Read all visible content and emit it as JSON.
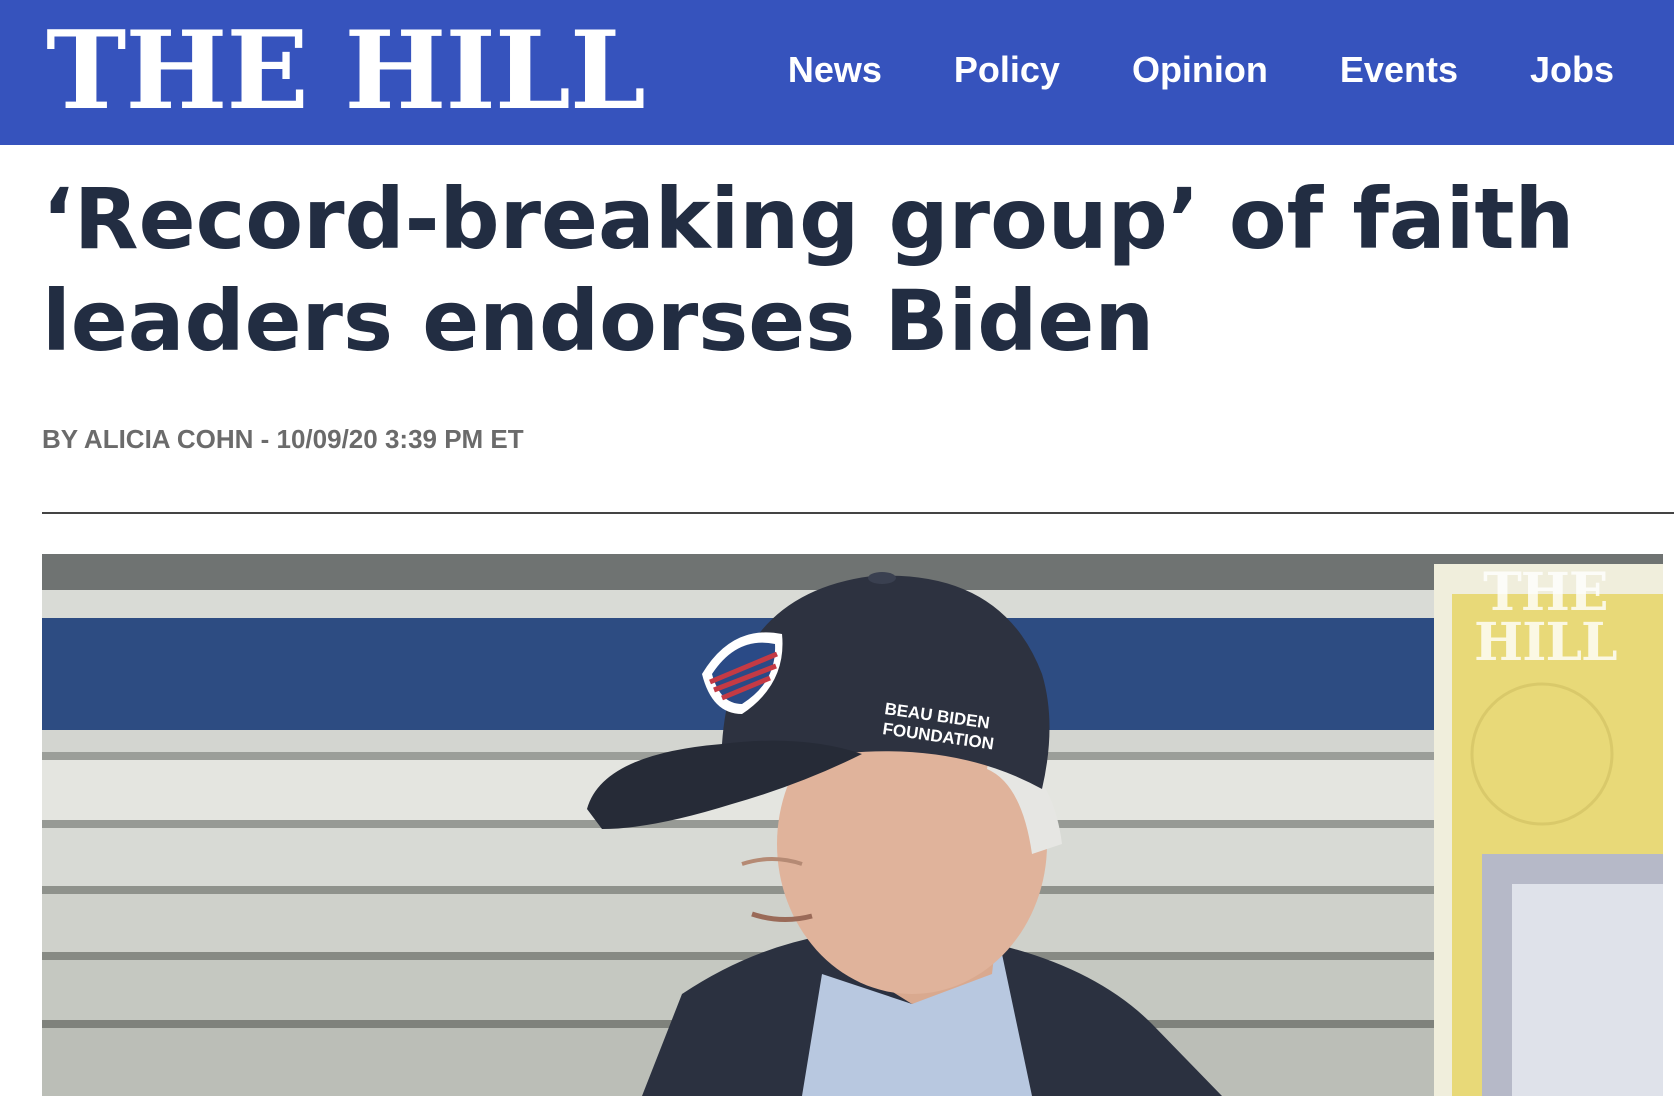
{
  "header": {
    "logo_text": "THE HILL",
    "nav": [
      {
        "label": "News"
      },
      {
        "label": "Policy"
      },
      {
        "label": "Opinion"
      },
      {
        "label": "Events"
      },
      {
        "label": "Jobs"
      }
    ],
    "brand_color": "#3653bd"
  },
  "article": {
    "headline": "‘Record-breaking group’ of faith leaders endorses Biden",
    "byline_prefix": "BY ",
    "author": "ALICIA COHN",
    "byline_separator": " - ",
    "timestamp": "10/09/20 3:39 PM ET",
    "headline_color": "#222d42"
  },
  "photo": {
    "cap_text_line1": "BEAU BIDEN",
    "cap_text_line2": "FOUNDATION",
    "watermark_line1": "THE",
    "watermark_line2": "HILL"
  }
}
